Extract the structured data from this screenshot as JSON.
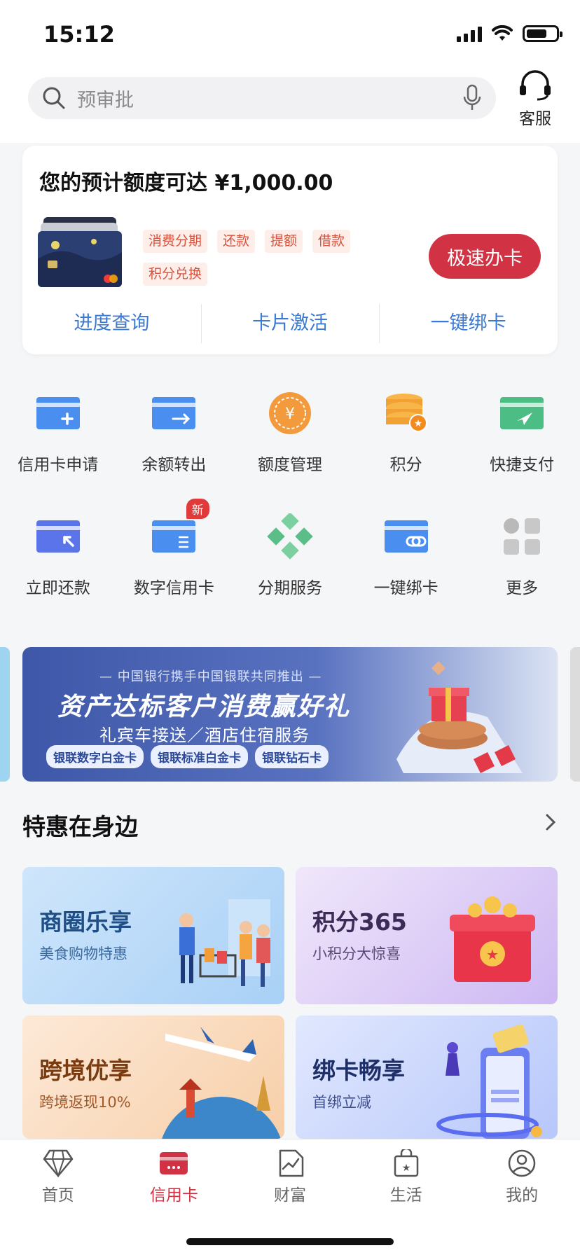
{
  "status": {
    "time": "15:12"
  },
  "search": {
    "placeholder": "预审批"
  },
  "service": {
    "label": "客服"
  },
  "credit": {
    "title": "您的预计额度可达 ¥1,000.00",
    "tags": [
      "消费分期",
      "还款",
      "提额",
      "借款",
      "积分兑换"
    ],
    "apply_label": "极速办卡",
    "links": [
      "进度查询",
      "卡片激活",
      "一键绑卡"
    ]
  },
  "grid": {
    "row1": [
      "信用卡申请",
      "余额转出",
      "额度管理",
      "积分",
      "快捷支付"
    ],
    "row2": [
      "立即还款",
      "数字信用卡",
      "分期服务",
      "一键绑卡",
      "更多"
    ],
    "new_badge": "新"
  },
  "banner": {
    "top_text": "— 中国银行携手中国银联共同推出 —",
    "title": "资产达标客户消费赢好礼",
    "subtitle": "礼宾车接送／酒店住宿服务",
    "pills": [
      "银联数字白金卡",
      "银联标准白金卡",
      "银联钻石卡"
    ]
  },
  "specials": {
    "title": "特惠在身边",
    "tiles": [
      {
        "title": "商圈乐享",
        "subtitle": "美食购物特惠"
      },
      {
        "title": "积分365",
        "subtitle": "小积分大惊喜"
      },
      {
        "title": "跨境优享",
        "subtitle": "跨境返现10%"
      },
      {
        "title": "绑卡畅享",
        "subtitle": "首绑立减"
      }
    ]
  },
  "nav": [
    "首页",
    "信用卡",
    "财富",
    "生活",
    "我的"
  ],
  "colors": {
    "accent": "#d23344",
    "link": "#3b7ad3"
  }
}
